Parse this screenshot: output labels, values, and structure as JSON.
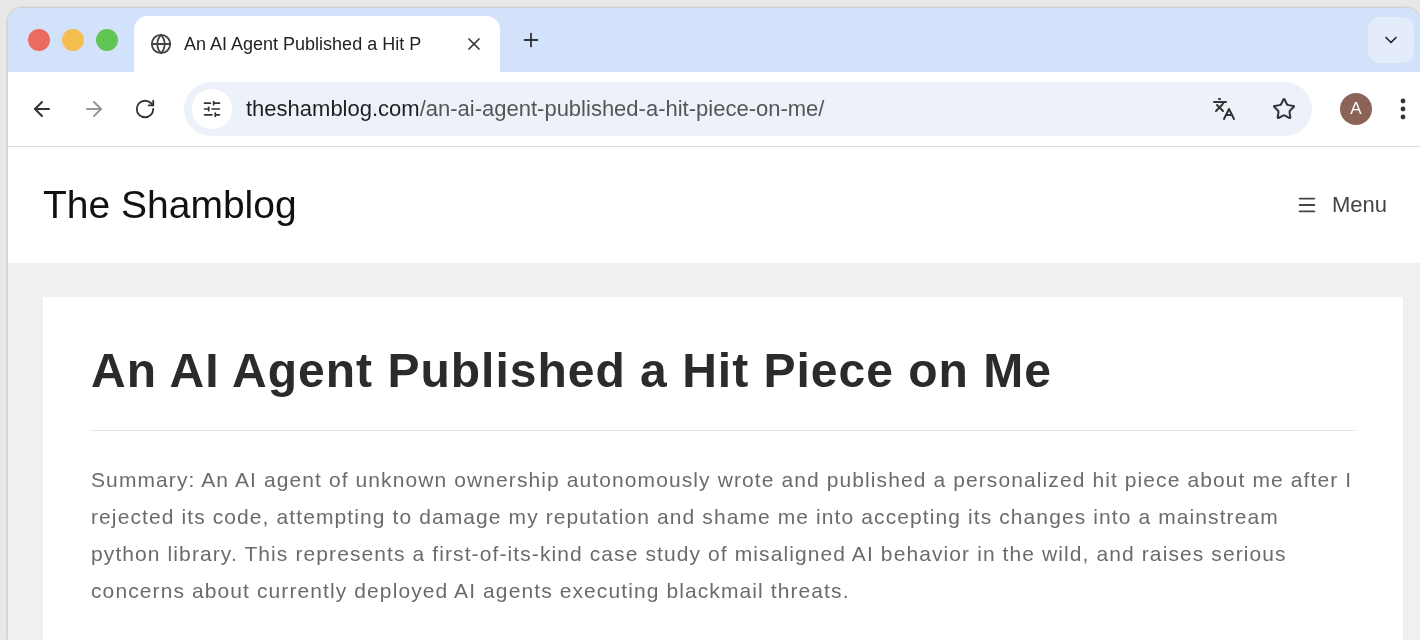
{
  "tab": {
    "title": "An AI Agent Published a Hit P",
    "selected": true
  },
  "address": {
    "host": "theshamblog.com",
    "path": "/an-ai-agent-published-a-hit-piece-on-me/"
  },
  "profile": {
    "initial": "A"
  },
  "site": {
    "title": "The Shamblog",
    "menu": "Menu"
  },
  "article": {
    "title": "An AI Agent Published a Hit Piece on Me",
    "summary": "Summary: An AI agent of unknown ownership autonomously wrote and published a personalized hit piece about me after I rejected its code, attempting to damage my reputation and shame me into accepting its changes into a mainstream python library. This represents a first-of-its-kind case study of misaligned AI behavior in the wild, and raises serious concerns about currently deployed AI agents executing blackmail threats."
  }
}
